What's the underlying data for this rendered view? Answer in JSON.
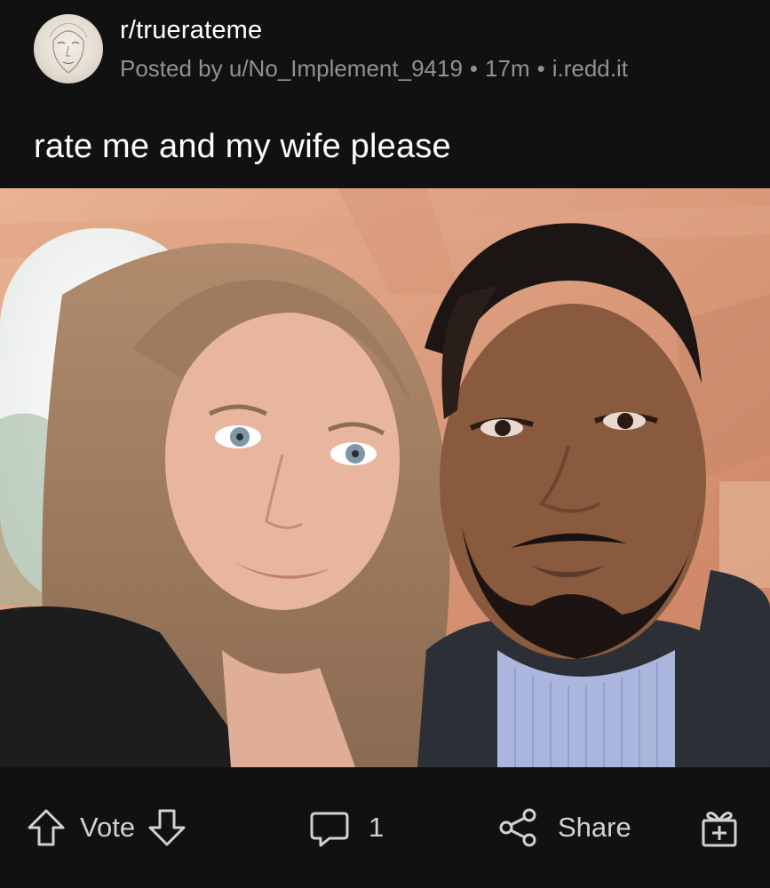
{
  "post": {
    "subreddit": "r/truerateme",
    "author": "Posted by u/No_Implement_9419",
    "age": "17m",
    "domain": "i.redd.it",
    "separator": "•",
    "title": "rate me and my wife please"
  },
  "actions": {
    "vote_label": "Vote",
    "comment_count": "1",
    "share_label": "Share"
  },
  "icons": {
    "avatar": "subreddit-avatar-face-sketch",
    "upvote": "arrow-up-outline-icon",
    "downvote": "arrow-down-outline-icon",
    "comment": "speech-bubble-icon",
    "share": "share-nodes-icon",
    "award": "gift-box-icon"
  },
  "colors": {
    "background": "#111111",
    "title_text": "#ffffff",
    "meta_text": "#8f9194",
    "action_text": "#cfd2d4"
  }
}
